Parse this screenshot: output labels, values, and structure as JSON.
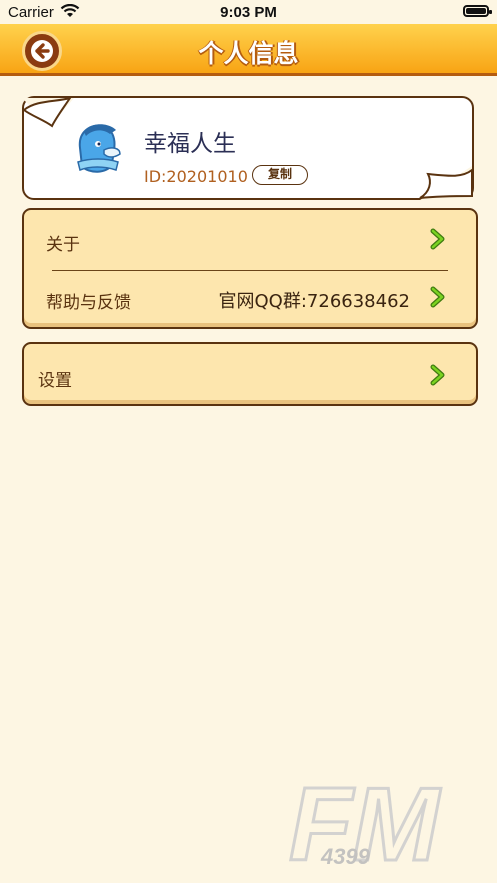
{
  "status_bar": {
    "carrier": "Carrier",
    "time": "9:03 PM",
    "battery_level": 1.0
  },
  "header": {
    "title": "个人信息",
    "back_icon": "back-arrow-icon"
  },
  "profile": {
    "username": "幸福人生",
    "id_text": "ID:20201010",
    "copy_label": "复制"
  },
  "menu": {
    "group1": [
      {
        "label": "关于",
        "value": ""
      },
      {
        "label": "帮助与反馈",
        "value": "官网QQ群:726638462"
      }
    ],
    "group2": [
      {
        "label": "设置",
        "value": ""
      }
    ]
  },
  "watermark": {
    "big": "FM",
    "small": "4399"
  },
  "colors": {
    "background": "#fdf6e3",
    "header": "#f8a414",
    "menu_bg": "#fde6ae",
    "border": "#5a3310",
    "chevron": "#7bd321",
    "username": "#2b2f55"
  }
}
